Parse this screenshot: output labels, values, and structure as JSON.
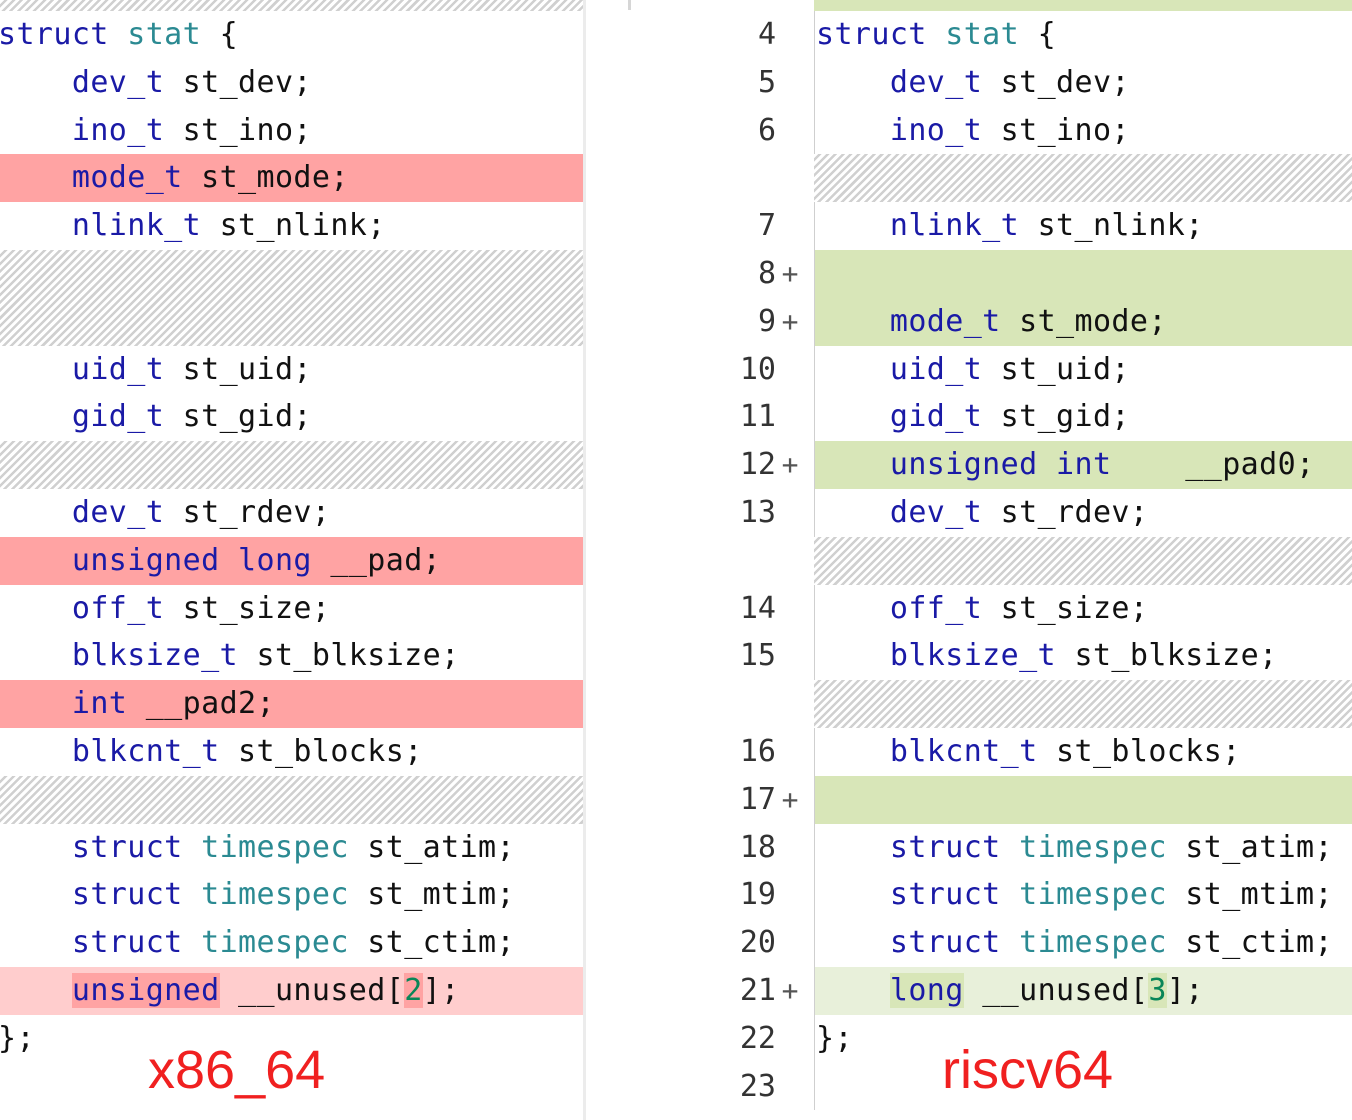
{
  "left": {
    "arch_label": "x86_64",
    "rows": [
      {
        "kind": "hatch-top"
      },
      {
        "kind": "ctx",
        "tokens": [
          [
            "kw",
            "struct"
          ],
          [
            "sp",
            " "
          ],
          [
            "ty",
            "stat"
          ],
          [
            "sp",
            " "
          ],
          [
            "pn",
            "{"
          ]
        ]
      },
      {
        "kind": "ctx",
        "tokens": [
          [
            "sp",
            "    "
          ],
          [
            "kw",
            "dev_t"
          ],
          [
            "sp",
            " "
          ],
          [
            "id",
            "st_dev"
          ],
          [
            "pn",
            ";"
          ]
        ]
      },
      {
        "kind": "ctx",
        "tokens": [
          [
            "sp",
            "    "
          ],
          [
            "kw",
            "ino_t"
          ],
          [
            "sp",
            " "
          ],
          [
            "id",
            "st_ino"
          ],
          [
            "pn",
            ";"
          ]
        ]
      },
      {
        "kind": "del",
        "tokens": [
          [
            "sp",
            "    "
          ],
          [
            "kw",
            "mode_t"
          ],
          [
            "sp",
            " "
          ],
          [
            "id",
            "st_mode"
          ],
          [
            "pn",
            ";"
          ]
        ]
      },
      {
        "kind": "ctx",
        "tokens": [
          [
            "sp",
            "    "
          ],
          [
            "kw",
            "nlink_t"
          ],
          [
            "sp",
            " "
          ],
          [
            "id",
            "st_nlink"
          ],
          [
            "pn",
            ";"
          ]
        ]
      },
      {
        "kind": "hatch",
        "span": 2
      },
      {
        "kind": "ctx",
        "tokens": [
          [
            "sp",
            "    "
          ],
          [
            "kw",
            "uid_t"
          ],
          [
            "sp",
            " "
          ],
          [
            "id",
            "st_uid"
          ],
          [
            "pn",
            ";"
          ]
        ]
      },
      {
        "kind": "ctx",
        "tokens": [
          [
            "sp",
            "    "
          ],
          [
            "kw",
            "gid_t"
          ],
          [
            "sp",
            " "
          ],
          [
            "id",
            "st_gid"
          ],
          [
            "pn",
            ";"
          ]
        ]
      },
      {
        "kind": "hatch",
        "span": 1
      },
      {
        "kind": "ctx",
        "tokens": [
          [
            "sp",
            "    "
          ],
          [
            "kw",
            "dev_t"
          ],
          [
            "sp",
            " "
          ],
          [
            "id",
            "st_rdev"
          ],
          [
            "pn",
            ";"
          ]
        ]
      },
      {
        "kind": "del",
        "tokens": [
          [
            "sp",
            "    "
          ],
          [
            "kw",
            "unsigned"
          ],
          [
            "sp",
            " "
          ],
          [
            "kw",
            "long"
          ],
          [
            "sp",
            " "
          ],
          [
            "id",
            "__pad"
          ],
          [
            "pn",
            ";"
          ]
        ]
      },
      {
        "kind": "ctx",
        "tokens": [
          [
            "sp",
            "    "
          ],
          [
            "kw",
            "off_t"
          ],
          [
            "sp",
            " "
          ],
          [
            "id",
            "st_size"
          ],
          [
            "pn",
            ";"
          ]
        ]
      },
      {
        "kind": "ctx",
        "tokens": [
          [
            "sp",
            "    "
          ],
          [
            "kw",
            "blksize_t"
          ],
          [
            "sp",
            " "
          ],
          [
            "id",
            "st_blksize"
          ],
          [
            "pn",
            ";"
          ]
        ]
      },
      {
        "kind": "del",
        "tokens": [
          [
            "sp",
            "    "
          ],
          [
            "kw",
            "int"
          ],
          [
            "sp",
            " "
          ],
          [
            "id",
            "__pad2"
          ],
          [
            "pn",
            ";"
          ]
        ]
      },
      {
        "kind": "ctx",
        "tokens": [
          [
            "sp",
            "    "
          ],
          [
            "kw",
            "blkcnt_t"
          ],
          [
            "sp",
            " "
          ],
          [
            "id",
            "st_blocks"
          ],
          [
            "pn",
            ";"
          ]
        ]
      },
      {
        "kind": "hatch",
        "span": 1
      },
      {
        "kind": "ctx",
        "tokens": [
          [
            "sp",
            "    "
          ],
          [
            "kw",
            "struct"
          ],
          [
            "sp",
            " "
          ],
          [
            "ty",
            "timespec"
          ],
          [
            "sp",
            " "
          ],
          [
            "id",
            "st_atim"
          ],
          [
            "pn",
            ";"
          ]
        ]
      },
      {
        "kind": "ctx",
        "tokens": [
          [
            "sp",
            "    "
          ],
          [
            "kw",
            "struct"
          ],
          [
            "sp",
            " "
          ],
          [
            "ty",
            "timespec"
          ],
          [
            "sp",
            " "
          ],
          [
            "id",
            "st_mtim"
          ],
          [
            "pn",
            ";"
          ]
        ]
      },
      {
        "kind": "ctx",
        "tokens": [
          [
            "sp",
            "    "
          ],
          [
            "kw",
            "struct"
          ],
          [
            "sp",
            " "
          ],
          [
            "ty",
            "timespec"
          ],
          [
            "sp",
            " "
          ],
          [
            "id",
            "st_ctim"
          ],
          [
            "pn",
            ";"
          ]
        ]
      },
      {
        "kind": "del-light",
        "tokens": [
          [
            "sp",
            "    "
          ],
          [
            "kwhl",
            "unsigned"
          ],
          [
            "sp",
            " "
          ],
          [
            "id",
            "__unused"
          ],
          [
            "pn",
            "["
          ],
          [
            "numhl",
            "2"
          ],
          [
            "pn",
            "];"
          ]
        ]
      },
      {
        "kind": "ctx",
        "tokens": [
          [
            "pn",
            "};"
          ]
        ]
      }
    ]
  },
  "right": {
    "arch_label": "riscv64",
    "rows": [
      {
        "kind": "add-top"
      },
      {
        "kind": "ctx",
        "ln": "4",
        "tokens": [
          [
            "kw",
            "struct"
          ],
          [
            "sp",
            " "
          ],
          [
            "ty",
            "stat"
          ],
          [
            "sp",
            " "
          ],
          [
            "pn",
            "{"
          ]
        ]
      },
      {
        "kind": "ctx",
        "ln": "5",
        "tokens": [
          [
            "sp",
            "    "
          ],
          [
            "kw",
            "dev_t"
          ],
          [
            "sp",
            " "
          ],
          [
            "id",
            "st_dev"
          ],
          [
            "pn",
            ";"
          ]
        ]
      },
      {
        "kind": "ctx",
        "ln": "6",
        "tokens": [
          [
            "sp",
            "    "
          ],
          [
            "kw",
            "ino_t"
          ],
          [
            "sp",
            " "
          ],
          [
            "id",
            "st_ino"
          ],
          [
            "pn",
            ";"
          ]
        ]
      },
      {
        "kind": "hatch",
        "span": 1
      },
      {
        "kind": "ctx",
        "ln": "7",
        "tokens": [
          [
            "sp",
            "    "
          ],
          [
            "kw",
            "nlink_t"
          ],
          [
            "sp",
            " "
          ],
          [
            "id",
            "st_nlink"
          ],
          [
            "pn",
            ";"
          ]
        ]
      },
      {
        "kind": "add",
        "ln": "8",
        "plus": "+",
        "tokens": []
      },
      {
        "kind": "add",
        "ln": "9",
        "plus": "+",
        "tokens": [
          [
            "sp",
            "    "
          ],
          [
            "kw",
            "mode_t"
          ],
          [
            "sp",
            " "
          ],
          [
            "id",
            "st_mode"
          ],
          [
            "pn",
            ";"
          ]
        ]
      },
      {
        "kind": "ctx",
        "ln": "10",
        "tokens": [
          [
            "sp",
            "    "
          ],
          [
            "kw",
            "uid_t"
          ],
          [
            "sp",
            " "
          ],
          [
            "id",
            "st_uid"
          ],
          [
            "pn",
            ";"
          ]
        ]
      },
      {
        "kind": "ctx",
        "ln": "11",
        "tokens": [
          [
            "sp",
            "    "
          ],
          [
            "kw",
            "gid_t"
          ],
          [
            "sp",
            " "
          ],
          [
            "id",
            "st_gid"
          ],
          [
            "pn",
            ";"
          ]
        ]
      },
      {
        "kind": "add",
        "ln": "12",
        "plus": "+",
        "tokens": [
          [
            "sp",
            "    "
          ],
          [
            "kw",
            "unsigned"
          ],
          [
            "sp",
            " "
          ],
          [
            "kw",
            "int"
          ],
          [
            "sp",
            "    "
          ],
          [
            "id",
            "__pad0"
          ],
          [
            "pn",
            ";"
          ]
        ]
      },
      {
        "kind": "ctx",
        "ln": "13",
        "tokens": [
          [
            "sp",
            "    "
          ],
          [
            "kw",
            "dev_t"
          ],
          [
            "sp",
            " "
          ],
          [
            "id",
            "st_rdev"
          ],
          [
            "pn",
            ";"
          ]
        ]
      },
      {
        "kind": "hatch",
        "span": 1
      },
      {
        "kind": "ctx",
        "ln": "14",
        "tokens": [
          [
            "sp",
            "    "
          ],
          [
            "kw",
            "off_t"
          ],
          [
            "sp",
            " "
          ],
          [
            "id",
            "st_size"
          ],
          [
            "pn",
            ";"
          ]
        ]
      },
      {
        "kind": "ctx",
        "ln": "15",
        "tokens": [
          [
            "sp",
            "    "
          ],
          [
            "kw",
            "blksize_t"
          ],
          [
            "sp",
            " "
          ],
          [
            "id",
            "st_blksize"
          ],
          [
            "pn",
            ";"
          ]
        ]
      },
      {
        "kind": "hatch",
        "span": 1
      },
      {
        "kind": "ctx",
        "ln": "16",
        "tokens": [
          [
            "sp",
            "    "
          ],
          [
            "kw",
            "blkcnt_t"
          ],
          [
            "sp",
            " "
          ],
          [
            "id",
            "st_blocks"
          ],
          [
            "pn",
            ";"
          ]
        ]
      },
      {
        "kind": "add",
        "ln": "17",
        "plus": "+",
        "tokens": []
      },
      {
        "kind": "ctx",
        "ln": "18",
        "tokens": [
          [
            "sp",
            "    "
          ],
          [
            "kw",
            "struct"
          ],
          [
            "sp",
            " "
          ],
          [
            "ty",
            "timespec"
          ],
          [
            "sp",
            " "
          ],
          [
            "id",
            "st_atim"
          ],
          [
            "pn",
            ";"
          ]
        ]
      },
      {
        "kind": "ctx",
        "ln": "19",
        "tokens": [
          [
            "sp",
            "    "
          ],
          [
            "kw",
            "struct"
          ],
          [
            "sp",
            " "
          ],
          [
            "ty",
            "timespec"
          ],
          [
            "sp",
            " "
          ],
          [
            "id",
            "st_mtim"
          ],
          [
            "pn",
            ";"
          ]
        ]
      },
      {
        "kind": "ctx",
        "ln": "20",
        "tokens": [
          [
            "sp",
            "    "
          ],
          [
            "kw",
            "struct"
          ],
          [
            "sp",
            " "
          ],
          [
            "ty",
            "timespec"
          ],
          [
            "sp",
            " "
          ],
          [
            "id",
            "st_ctim"
          ],
          [
            "pn",
            ";"
          ]
        ]
      },
      {
        "kind": "add-light",
        "ln": "21",
        "plus": "+",
        "tokens": [
          [
            "sp",
            "    "
          ],
          [
            "kwhladd",
            "long"
          ],
          [
            "sp",
            " "
          ],
          [
            "id",
            "__unused"
          ],
          [
            "pn",
            "["
          ],
          [
            "numhladd",
            "3"
          ],
          [
            "pn",
            "];"
          ]
        ]
      },
      {
        "kind": "ctx",
        "ln": "22",
        "tokens": [
          [
            "pn",
            "};"
          ]
        ]
      },
      {
        "kind": "ctx",
        "ln": "23",
        "tokens": []
      }
    ]
  },
  "colors": {
    "deleted": "#ffa3a3",
    "deleted_light": "#ffcdcd",
    "added": "#d8e6b8",
    "added_light": "#e8f0da",
    "keyword": "#1a1aa6",
    "type": "#2b8a92",
    "label": "#f02020"
  }
}
